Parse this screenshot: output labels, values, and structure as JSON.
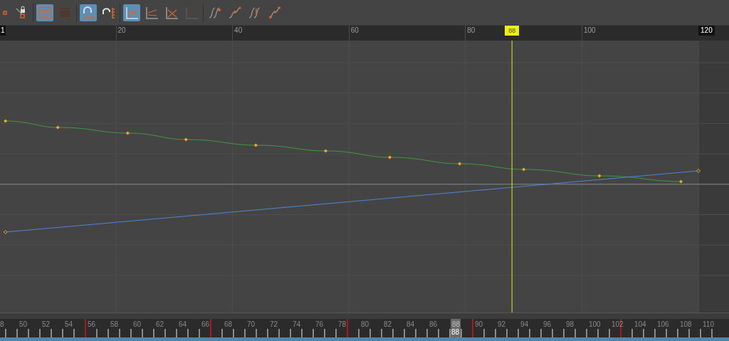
{
  "toolbar": {
    "buttons": [
      {
        "kind": "key",
        "selected": false
      },
      {
        "kind": "lock",
        "selected": false
      },
      {
        "kind": "window",
        "selected": true
      },
      {
        "kind": "window-dim",
        "selected": false
      },
      {
        "kind": "magnet",
        "selected": true
      },
      {
        "kind": "magnet-ruler",
        "selected": false
      },
      {
        "kind": "graph-cross",
        "selected": true
      },
      {
        "kind": "graph-lines",
        "selected": false
      },
      {
        "kind": "graph-x",
        "selected": false
      },
      {
        "kind": "graph-dim",
        "selected": false
      },
      {
        "kind": "tangent-step",
        "selected": false
      },
      {
        "kind": "tangent-smooth",
        "selected": false
      },
      {
        "kind": "tangent-step2",
        "selected": false
      },
      {
        "kind": "tangent-linear",
        "selected": false
      }
    ]
  },
  "ruler": {
    "start_label": "1",
    "end_label": "120",
    "labels": [
      "20",
      "40",
      "60",
      "80",
      "100"
    ]
  },
  "playhead": {
    "label": "88",
    "level": 0.731
  },
  "time_slider": {
    "labels": [
      "8",
      "50",
      "52",
      "54",
      "56",
      "58",
      "60",
      "62",
      "64",
      "66",
      "68",
      "70",
      "72",
      "74",
      "76",
      "78",
      "80",
      "82",
      "84",
      "86",
      "88",
      "90",
      "92",
      "94",
      "96",
      "98",
      "100",
      "102",
      "104",
      "106",
      "108",
      "110"
    ],
    "current_label": "88"
  }
}
